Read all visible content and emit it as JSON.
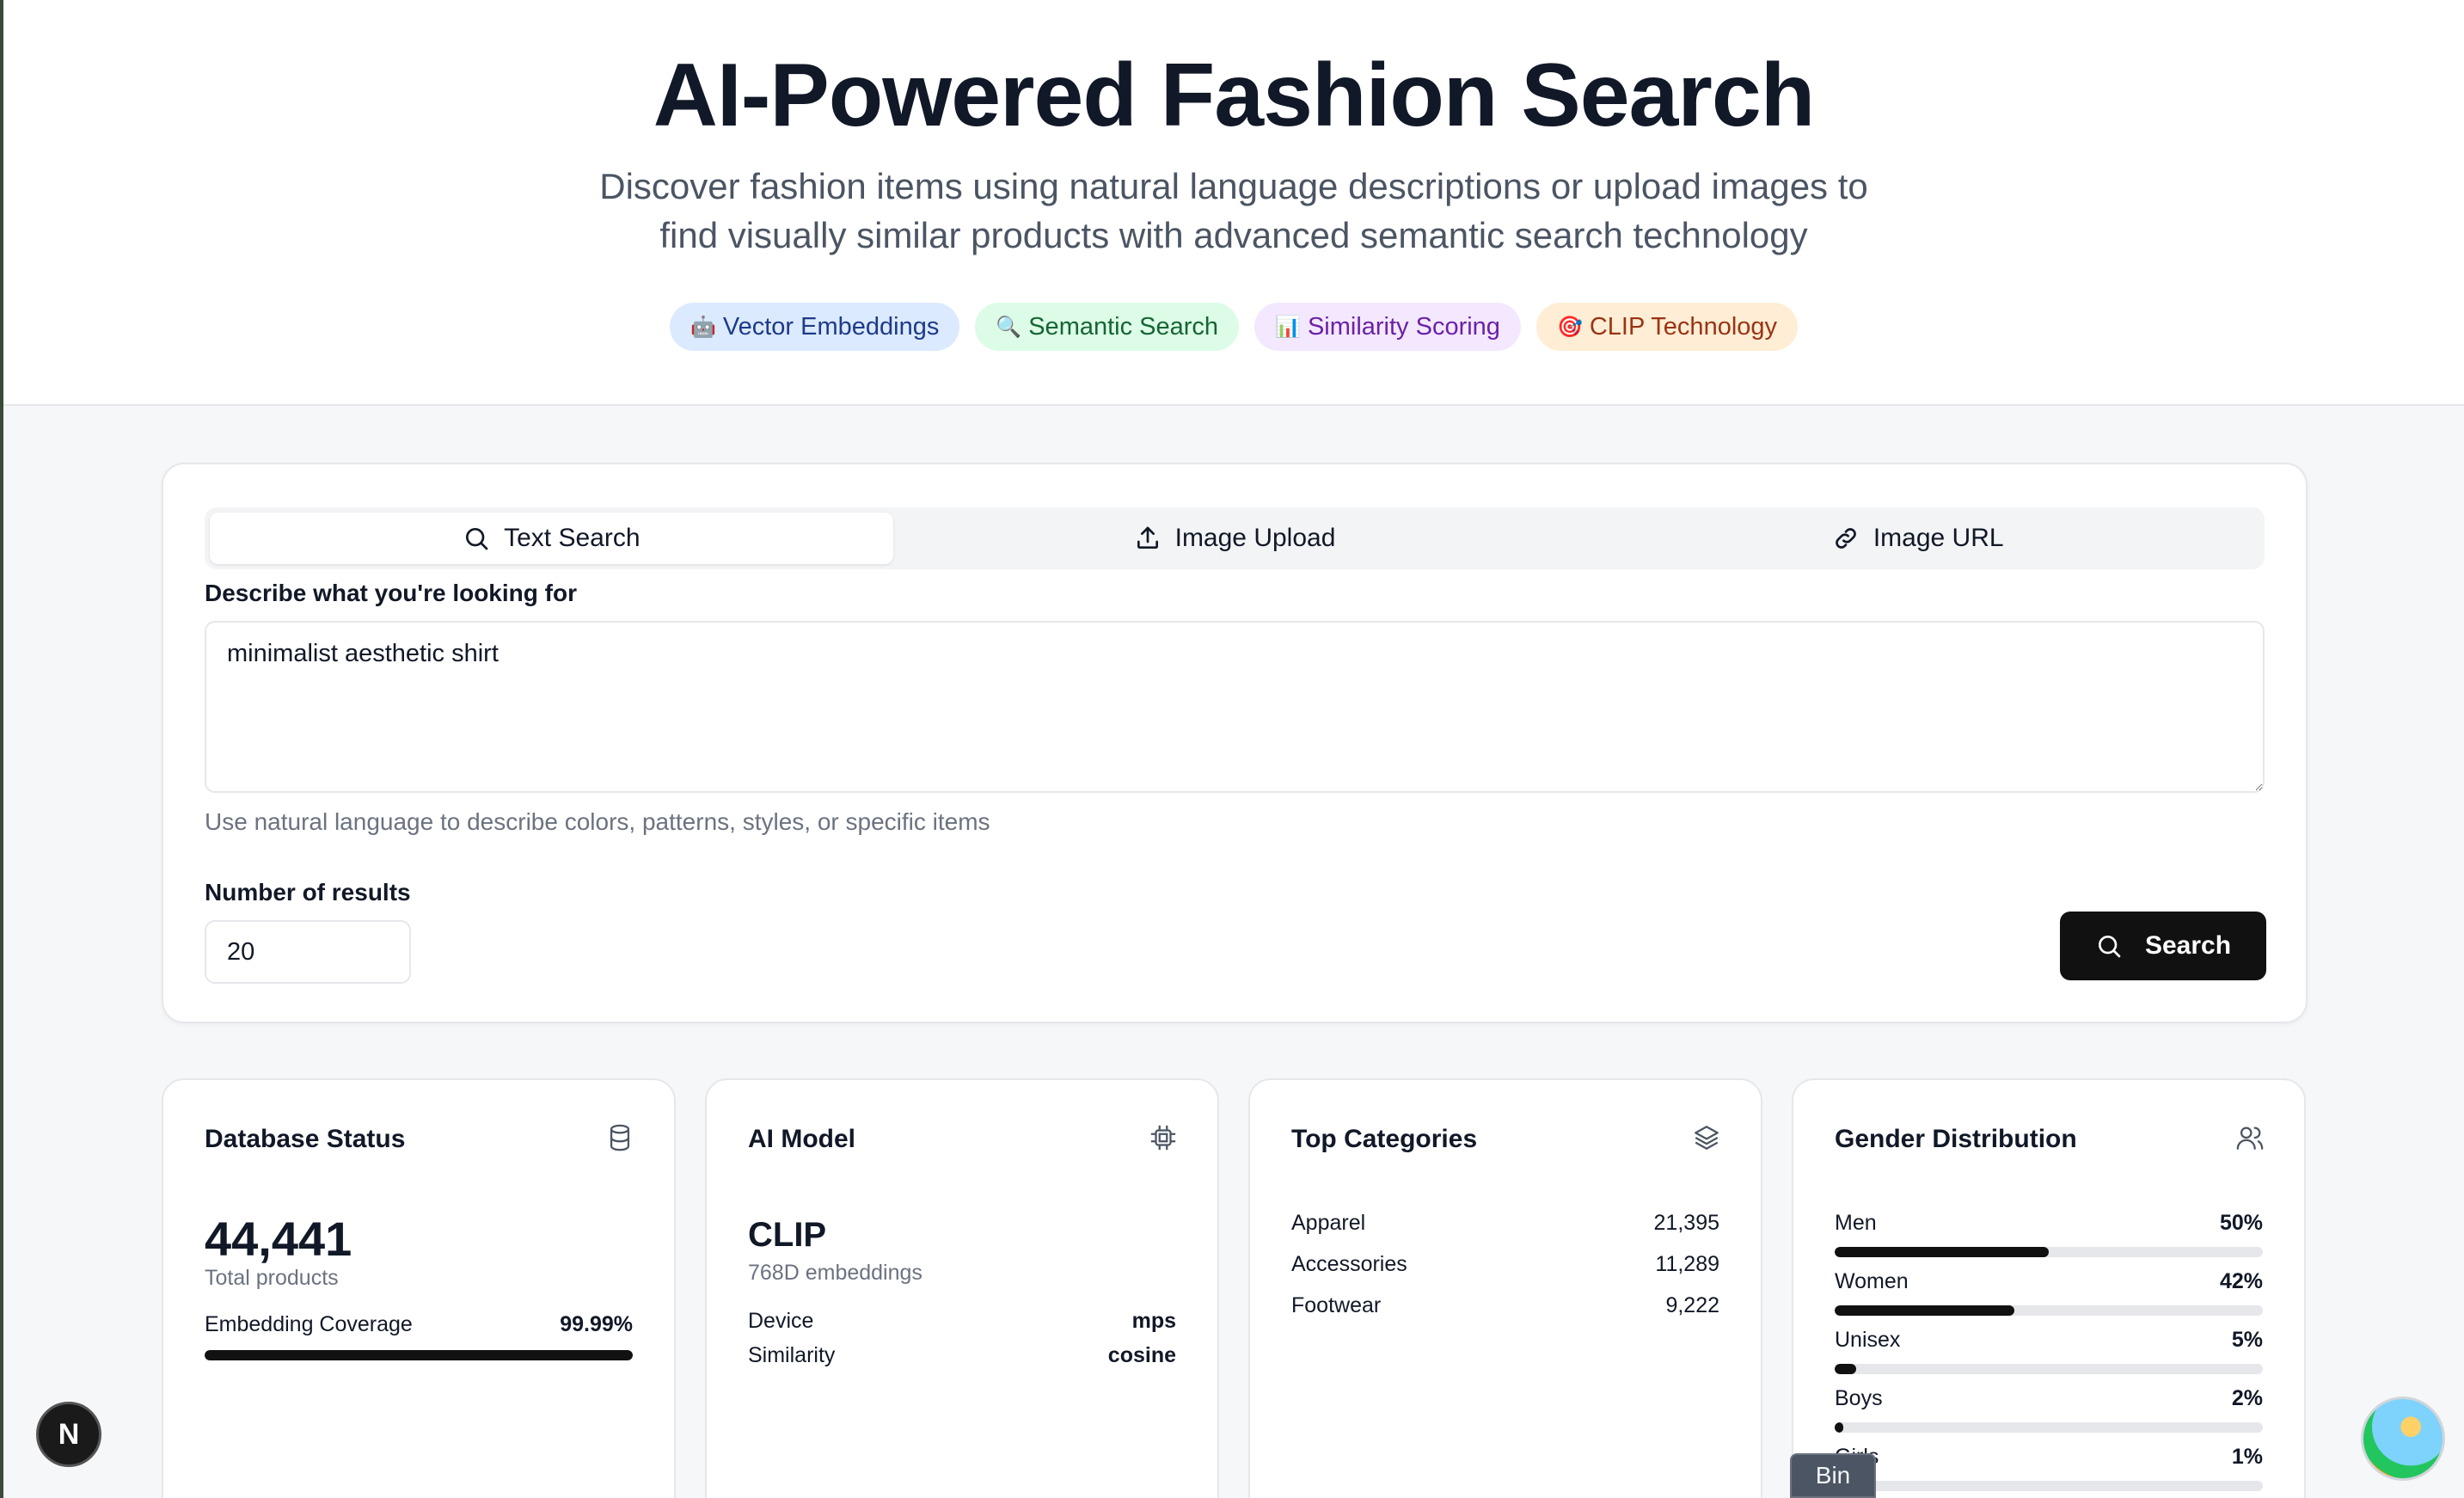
{
  "header": {
    "title": "AI-Powered Fashion Search",
    "subtitle_line1": "Discover fashion items using natural language descriptions or upload images to",
    "subtitle_line2": "find visually similar products with advanced semantic search technology",
    "chips": [
      {
        "emoji": "🤖",
        "label": "Vector Embeddings"
      },
      {
        "emoji": "🔍",
        "label": "Semantic Search"
      },
      {
        "emoji": "📊",
        "label": "Similarity Scoring"
      },
      {
        "emoji": "🎯",
        "label": "CLIP Technology"
      }
    ]
  },
  "search": {
    "tabs": [
      {
        "label": "Text Search",
        "icon": "search-icon",
        "active": true
      },
      {
        "label": "Image Upload",
        "icon": "upload-icon",
        "active": false
      },
      {
        "label": "Image URL",
        "icon": "link-icon",
        "active": false
      }
    ],
    "query_label": "Describe what you're looking for",
    "query_value": "minimalist aesthetic shirt",
    "hint": "Use natural language to describe colors, patterns, styles, or specific items",
    "count_label": "Number of results",
    "count_value": "20",
    "button_label": "Search"
  },
  "stats": {
    "database": {
      "title": "Database Status",
      "icon": "database-icon",
      "total": "44,441",
      "total_label": "Total products",
      "coverage_label": "Embedding Coverage",
      "coverage_value": "99.99%",
      "coverage_fraction": 0.9999
    },
    "model": {
      "title": "AI Model",
      "icon": "cpu-icon",
      "name": "CLIP",
      "embeddings": "768D embeddings",
      "device_label": "Device",
      "device_value": "mps",
      "similarity_label": "Similarity",
      "similarity_value": "cosine"
    },
    "categories": {
      "title": "Top Categories",
      "icon": "layers-icon",
      "items": [
        {
          "name": "Apparel",
          "count": "21,395"
        },
        {
          "name": "Accessories",
          "count": "11,289"
        },
        {
          "name": "Footwear",
          "count": "9,222"
        }
      ]
    },
    "gender": {
      "title": "Gender Distribution",
      "icon": "users-icon",
      "items": [
        {
          "name": "Men",
          "pct": "50%",
          "fraction": 0.5
        },
        {
          "name": "Women",
          "pct": "42%",
          "fraction": 0.42
        },
        {
          "name": "Unisex",
          "pct": "5%",
          "fraction": 0.05
        },
        {
          "name": "Boys",
          "pct": "2%",
          "fraction": 0.02
        },
        {
          "name": "Girls",
          "pct": "1%",
          "fraction": 0.01
        }
      ]
    }
  },
  "overlay": {
    "nextjs_badge": "N",
    "bin_tooltip": "Bin"
  }
}
